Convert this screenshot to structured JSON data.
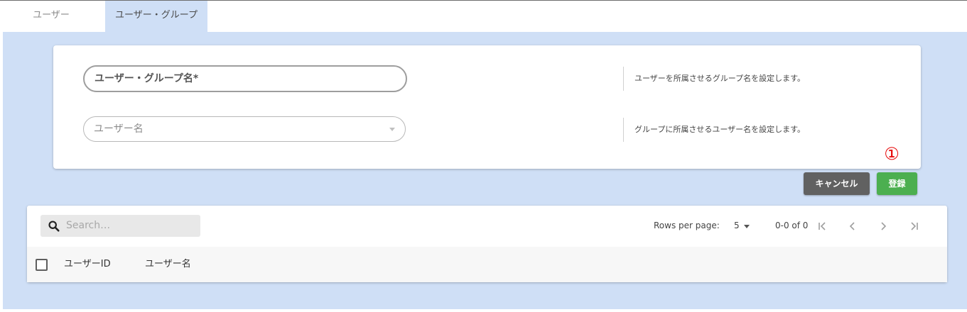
{
  "tabs": {
    "users": "ユーザー",
    "user_groups": "ユーザー・グループ"
  },
  "form": {
    "group_name_label": "ユーザー・グループ名*",
    "group_name_help": "ユーザーを所属させるグループ名を設定します。",
    "user_name_label": "ユーザー名",
    "user_name_help": "グループに所属させるユーザー名を設定します。"
  },
  "annotation_marker": "①",
  "buttons": {
    "cancel": "キャンセル",
    "register": "登録"
  },
  "table": {
    "search_placeholder": "Search…",
    "rows_per_page_label": "Rows per page:",
    "rows_per_page_value": "5",
    "range": "0-0 of 0",
    "columns": [
      "ユーザーID",
      "ユーザー名"
    ]
  },
  "colors": {
    "accent_bg": "#cfdff6",
    "save_button": "#4caf50",
    "cancel_button": "#616161",
    "marker": "#e60000"
  },
  "icons": [
    "search-icon",
    "first-page-icon",
    "prev-page-icon",
    "next-page-icon",
    "last-page-icon",
    "dropdown-arrow-icon"
  ]
}
